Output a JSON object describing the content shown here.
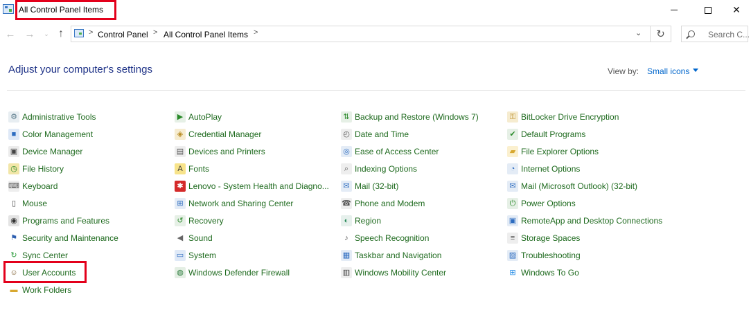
{
  "window": {
    "title": "All Control Panel Items",
    "minimize_glyph": "",
    "close_glyph": "✕"
  },
  "nav": {
    "back_glyph": "←",
    "forward_glyph": "→",
    "recent_glyph": "⌄",
    "up_glyph": "↑",
    "refresh_glyph": "↻",
    "dropdown_glyph": "⌄",
    "separator": ">"
  },
  "address": {
    "breadcrumbs": [
      "Control Panel",
      "All Control Panel Items"
    ]
  },
  "search": {
    "placeholder": "Search C..."
  },
  "header": {
    "title": "Adjust your computer's settings",
    "view_by_label": "View by:",
    "view_by_value": "Small icons"
  },
  "colors": {
    "link_green": "#1e6a1e",
    "heading_blue": "#1e3287",
    "accent_blue": "#0066cc",
    "highlight_red": "#e3001b"
  },
  "columns": [
    {
      "items": [
        {
          "label": "Administrative Tools",
          "icon": "admin-tools-icon",
          "glyph": "⚙",
          "color": "#5a7a8a",
          "bg": "#e8eef2"
        },
        {
          "label": "Color Management",
          "icon": "color-management-icon",
          "glyph": "■",
          "color": "#2d6cc0",
          "bg": "#dfe9f7"
        },
        {
          "label": "Device Manager",
          "icon": "device-manager-icon",
          "glyph": "▣",
          "color": "#444",
          "bg": "#ececec"
        },
        {
          "label": "File History",
          "icon": "file-history-icon",
          "glyph": "◷",
          "color": "#2a8a2a",
          "bg": "#f2e6a8"
        },
        {
          "label": "Keyboard",
          "icon": "keyboard-icon",
          "glyph": "⌨",
          "color": "#555",
          "bg": "#eeeeee"
        },
        {
          "label": "Mouse",
          "icon": "mouse-icon",
          "glyph": "▯",
          "color": "#444",
          "bg": "#ffffff"
        },
        {
          "label": "Programs and Features",
          "icon": "programs-features-icon",
          "glyph": "◉",
          "color": "#333",
          "bg": "#e4e4e4"
        },
        {
          "label": "Security and Maintenance",
          "icon": "flag-icon",
          "glyph": "⚑",
          "color": "#2d5fb0",
          "bg": "#ffffff"
        },
        {
          "label": "Sync Center",
          "icon": "sync-icon",
          "glyph": "↻",
          "color": "#2a9a3a",
          "bg": "#ffffff"
        },
        {
          "label": "User Accounts",
          "icon": "user-accounts-icon",
          "glyph": "☺",
          "color": "#7a5a2a",
          "bg": "#ffffff"
        },
        {
          "label": "Work Folders",
          "icon": "work-folders-icon",
          "glyph": "▬",
          "color": "#d8a830",
          "bg": "#ffffff"
        }
      ]
    },
    {
      "items": [
        {
          "label": "AutoPlay",
          "icon": "autoplay-icon",
          "glyph": "▶",
          "color": "#2a8a2a",
          "bg": "#e6f0e6"
        },
        {
          "label": "Credential Manager",
          "icon": "credential-manager-icon",
          "glyph": "◈",
          "color": "#b88a20",
          "bg": "#f6ecd0"
        },
        {
          "label": "Devices and Printers",
          "icon": "printer-icon",
          "glyph": "▤",
          "color": "#555",
          "bg": "#eeeeee"
        },
        {
          "label": "Fonts",
          "icon": "fonts-icon",
          "glyph": "A",
          "color": "#333",
          "bg": "#f7e38a"
        },
        {
          "label": "Lenovo - System Health and Diagno...",
          "icon": "lenovo-icon",
          "glyph": "✱",
          "color": "#ffffff",
          "bg": "#d42a2a"
        },
        {
          "label": "Network and Sharing Center",
          "icon": "network-icon",
          "glyph": "⊞",
          "color": "#2d6cc0",
          "bg": "#e4ecf6"
        },
        {
          "label": "Recovery",
          "icon": "recovery-icon",
          "glyph": "↺",
          "color": "#2a8a2a",
          "bg": "#e6f0e6"
        },
        {
          "label": "Sound",
          "icon": "speaker-icon",
          "glyph": "◀",
          "color": "#666",
          "bg": "#ffffff"
        },
        {
          "label": "System",
          "icon": "system-icon",
          "glyph": "▭",
          "color": "#2d6cc0",
          "bg": "#dfe9f7"
        },
        {
          "label": "Windows Defender Firewall",
          "icon": "firewall-icon",
          "glyph": "◍",
          "color": "#2a7a3a",
          "bg": "#e4efe4"
        }
      ]
    },
    {
      "items": [
        {
          "label": "Backup and Restore (Windows 7)",
          "icon": "backup-restore-icon",
          "glyph": "⇅",
          "color": "#2a8a2a",
          "bg": "#e6f0e6"
        },
        {
          "label": "Date and Time",
          "icon": "date-time-icon",
          "glyph": "◴",
          "color": "#555",
          "bg": "#eeeeee"
        },
        {
          "label": "Ease of Access Center",
          "icon": "ease-of-access-icon",
          "glyph": "◎",
          "color": "#2d6cc0",
          "bg": "#e4ecf6"
        },
        {
          "label": "Indexing Options",
          "icon": "indexing-icon",
          "glyph": "⌕",
          "color": "#555",
          "bg": "#eeeeee"
        },
        {
          "label": "Mail (32-bit)",
          "icon": "mail-icon",
          "glyph": "✉",
          "color": "#2d6cc0",
          "bg": "#e4ecf6"
        },
        {
          "label": "Phone and Modem",
          "icon": "phone-modem-icon",
          "glyph": "☎",
          "color": "#555",
          "bg": "#eeeeee"
        },
        {
          "label": "Region",
          "icon": "globe-icon",
          "glyph": "◐",
          "color": "#2a8a5a",
          "bg": "#e6f0ec"
        },
        {
          "label": "Speech Recognition",
          "icon": "microphone-icon",
          "glyph": "♪",
          "color": "#555",
          "bg": "#ffffff"
        },
        {
          "label": "Taskbar and Navigation",
          "icon": "taskbar-icon",
          "glyph": "▦",
          "color": "#2d6cc0",
          "bg": "#e4ecf6"
        },
        {
          "label": "Windows Mobility Center",
          "icon": "mobility-center-icon",
          "glyph": "▥",
          "color": "#444",
          "bg": "#eeeeee"
        }
      ]
    },
    {
      "items": [
        {
          "label": "BitLocker Drive Encryption",
          "icon": "bitlocker-icon",
          "glyph": "⚿",
          "color": "#b88a20",
          "bg": "#f6ecd0"
        },
        {
          "label": "Default Programs",
          "icon": "default-programs-icon",
          "glyph": "✔",
          "color": "#2a8a2a",
          "bg": "#e6f0e6"
        },
        {
          "label": "File Explorer Options",
          "icon": "folder-options-icon",
          "glyph": "▰",
          "color": "#d8a830",
          "bg": "#fbf0cf"
        },
        {
          "label": "Internet Options",
          "icon": "internet-options-icon",
          "glyph": "◔",
          "color": "#2d6cc0",
          "bg": "#e4ecf6"
        },
        {
          "label": "Mail (Microsoft Outlook) (32-bit)",
          "icon": "mail-icon",
          "glyph": "✉",
          "color": "#2d6cc0",
          "bg": "#e4ecf6"
        },
        {
          "label": "Power Options",
          "icon": "power-icon",
          "glyph": "⏻",
          "color": "#2a8a2a",
          "bg": "#e6f0e6"
        },
        {
          "label": "RemoteApp and Desktop Connections",
          "icon": "remoteapp-icon",
          "glyph": "▣",
          "color": "#2d6cc0",
          "bg": "#e4ecf6"
        },
        {
          "label": "Storage Spaces",
          "icon": "storage-icon",
          "glyph": "≡",
          "color": "#555",
          "bg": "#eeeeee"
        },
        {
          "label": "Troubleshooting",
          "icon": "troubleshooting-icon",
          "glyph": "▨",
          "color": "#2d6cc0",
          "bg": "#e4ecf6"
        },
        {
          "label": "Windows To Go",
          "icon": "windows-logo-icon",
          "glyph": "⊞",
          "color": "#1e88e5",
          "bg": "#ffffff"
        }
      ]
    }
  ]
}
